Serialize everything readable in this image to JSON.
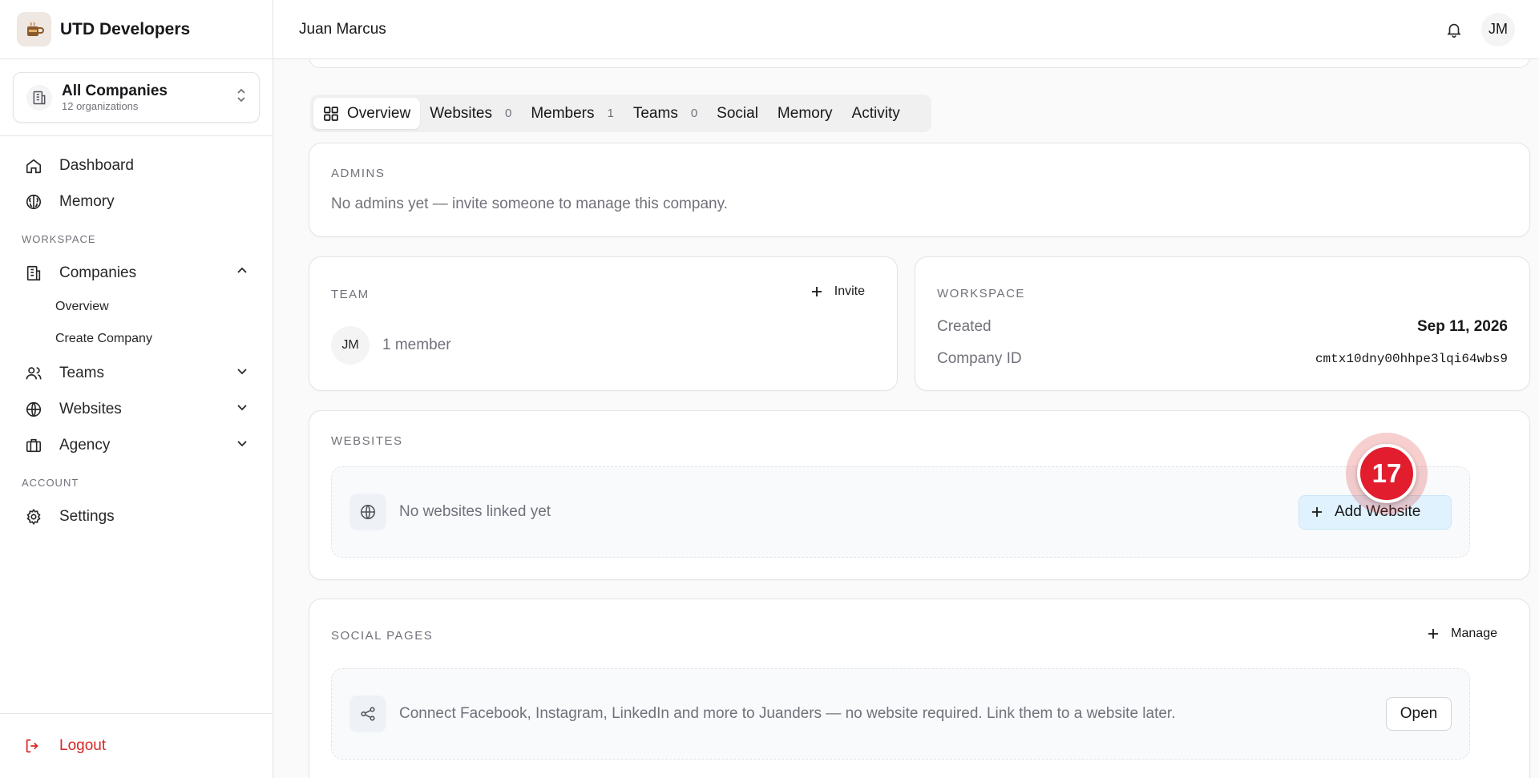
{
  "brand": {
    "title": "UTD Developers",
    "logo_icon": "coffee-cup-logo"
  },
  "org_switcher": {
    "title": "All Companies",
    "subtitle": "12 organizations"
  },
  "sidebar": {
    "items_top": [
      {
        "label": "Dashboard",
        "icon": "home-icon"
      },
      {
        "label": "Memory",
        "icon": "brain-icon"
      }
    ],
    "workspace_heading": "WORKSPACE",
    "companies": {
      "label": "Companies",
      "expanded": true,
      "sub_items": [
        {
          "label": "Overview"
        },
        {
          "label": "Create Company"
        }
      ]
    },
    "teams": {
      "label": "Teams"
    },
    "websites": {
      "label": "Websites"
    },
    "agency": {
      "label": "Agency"
    },
    "account_heading": "ACCOUNT",
    "settings": {
      "label": "Settings"
    },
    "logout": {
      "label": "Logout"
    }
  },
  "header": {
    "user_name": "Juan Marcus",
    "avatar_initials": "JM"
  },
  "tabs": [
    {
      "label": "Overview",
      "active": true
    },
    {
      "label": "Websites",
      "count": "0"
    },
    {
      "label": "Members",
      "count": "1"
    },
    {
      "label": "Teams",
      "count": "0"
    },
    {
      "label": "Social"
    },
    {
      "label": "Memory"
    },
    {
      "label": "Activity"
    }
  ],
  "admins": {
    "heading": "ADMINS",
    "empty_text": "No admins yet — invite someone to manage this company."
  },
  "team": {
    "heading": "TEAM",
    "invite_label": "Invite",
    "member_initials": "JM",
    "member_count_text": "1 member"
  },
  "workspace": {
    "heading": "WORKSPACE",
    "created_label": "Created",
    "created_value": "Sep 11, 2026",
    "company_id_label": "Company ID",
    "company_id_value": "cmtx10dny00hhpe3lqi64wbs9"
  },
  "websites": {
    "heading": "WEBSITES",
    "empty_text": "No websites linked yet",
    "add_button_label": "Add Website"
  },
  "social_pages": {
    "heading": "SOCIAL PAGES",
    "manage_label": "Manage",
    "empty_text": "Connect Facebook, Instagram, LinkedIn and more to Juanders — no website required. Link them to a website later.",
    "open_label": "Open"
  },
  "step_marker": {
    "number": "17",
    "color": "#e11d2e"
  },
  "colors": {
    "logout": "#dc2626",
    "accent_button": "#e0f2fe"
  }
}
